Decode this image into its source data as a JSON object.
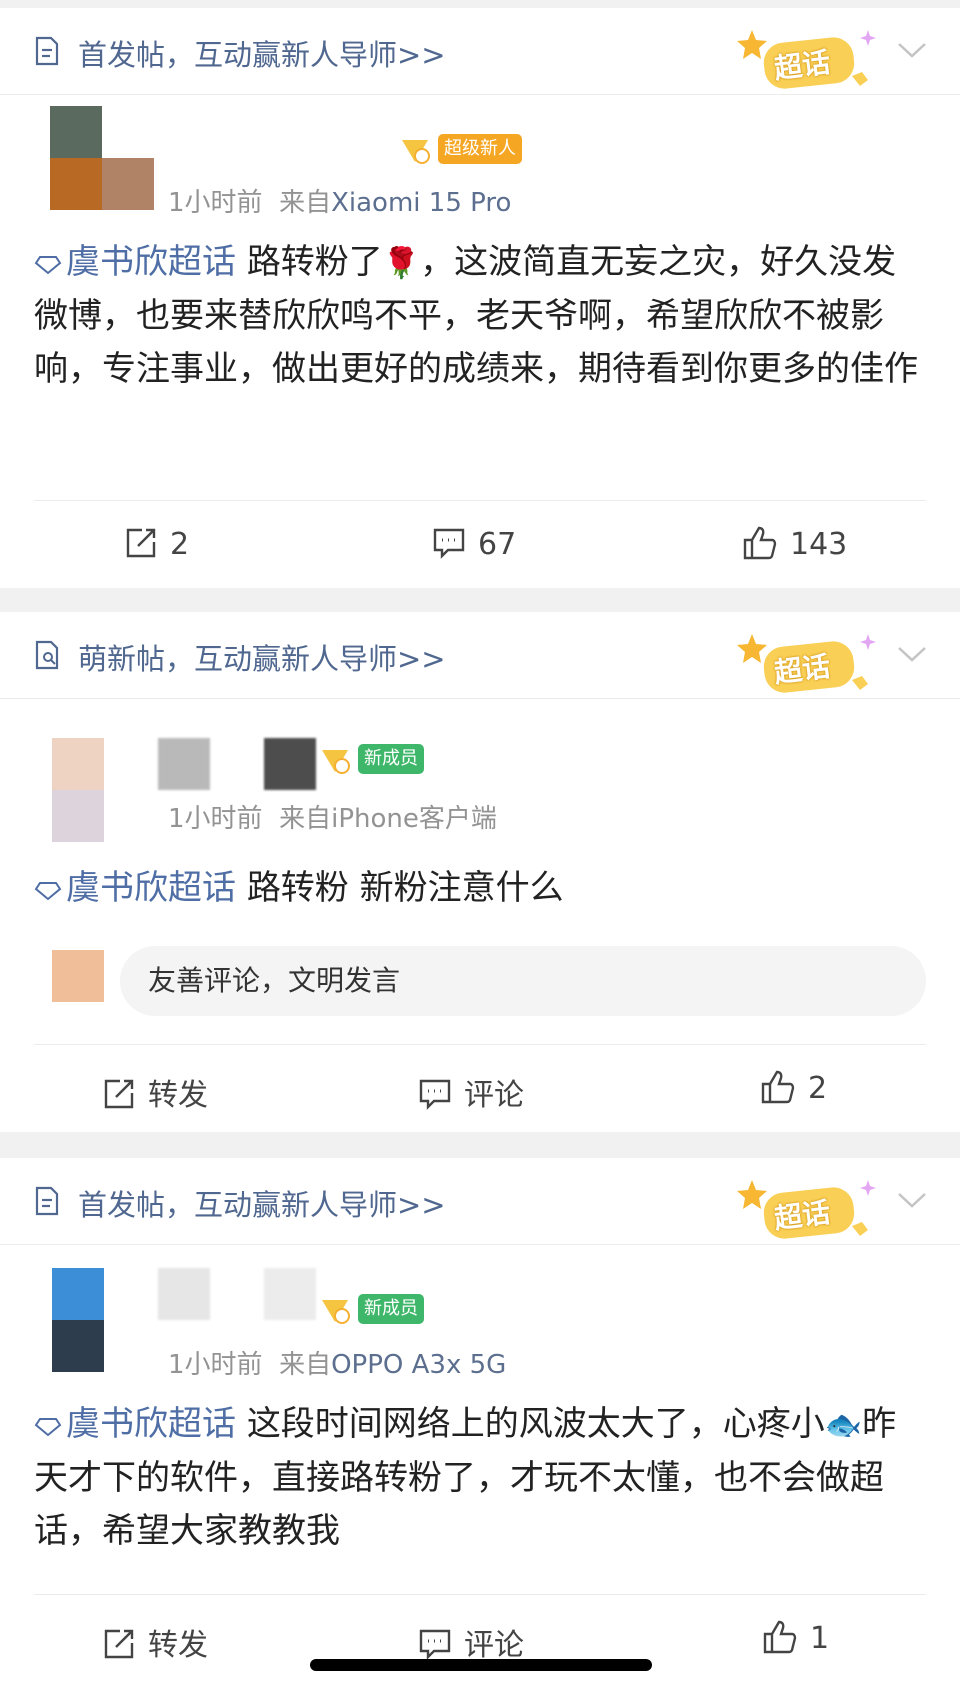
{
  "posts": [
    {
      "header": "首发帖，互动赢新人导师>>",
      "badge": "超话",
      "tag": "超级新人",
      "tag_color": "#f5a623",
      "meta_time": "1小时前",
      "meta_from": "来自",
      "meta_device": "Xiaomi 15 Pro",
      "topic": "虞书欣超话",
      "text_a": "路转粉了",
      "emoji": "🌹",
      "text_b": "，这波简直无妄之灾，好久没发微博，也要来替欣欣鸣不平，老天爷啊，希望欣欣不被影响，专注事业，做出更好的成绩来，期待看到你更多的佳作",
      "repost": "2",
      "comment": "67",
      "like": "143"
    },
    {
      "header": "萌新帖，互动赢新人导师>>",
      "badge": "超话",
      "tag": "新成员",
      "tag_color": "#3fb76a",
      "meta_time": "1小时前",
      "meta_from": "来自",
      "meta_device": "iPhone客户端",
      "topic": "虞书欣超话",
      "text_a": "路转粉 新粉注意什么",
      "comment_placeholder": "友善评论，文明发言",
      "repost": "转发",
      "comment": "评论",
      "like": "2"
    },
    {
      "header": "首发帖，互动赢新人导师>>",
      "badge": "超话",
      "tag": "新成员",
      "tag_color": "#3fb76a",
      "meta_time": "1小时前",
      "meta_from": "来自",
      "meta_device": "OPPO A3x 5G",
      "topic": "虞书欣超话",
      "text_a": "这段时间网络上的风波太大了，心疼小",
      "emoji": "🐟",
      "text_b": "昨天才下的软件，直接路转粉了，才玩不太懂，也不会做超话，希望大家教教我",
      "repost": "转发",
      "comment": "评论",
      "like": "1"
    }
  ],
  "colors": {
    "link": "#50678f",
    "topic": "#4f6ea5",
    "badge": "#f7c34a"
  },
  "icons": [
    "doc-icon",
    "supertopic-badge",
    "chevron-down-icon",
    "vip-icon",
    "diamond-icon",
    "repost-icon",
    "comment-icon",
    "like-icon"
  ]
}
